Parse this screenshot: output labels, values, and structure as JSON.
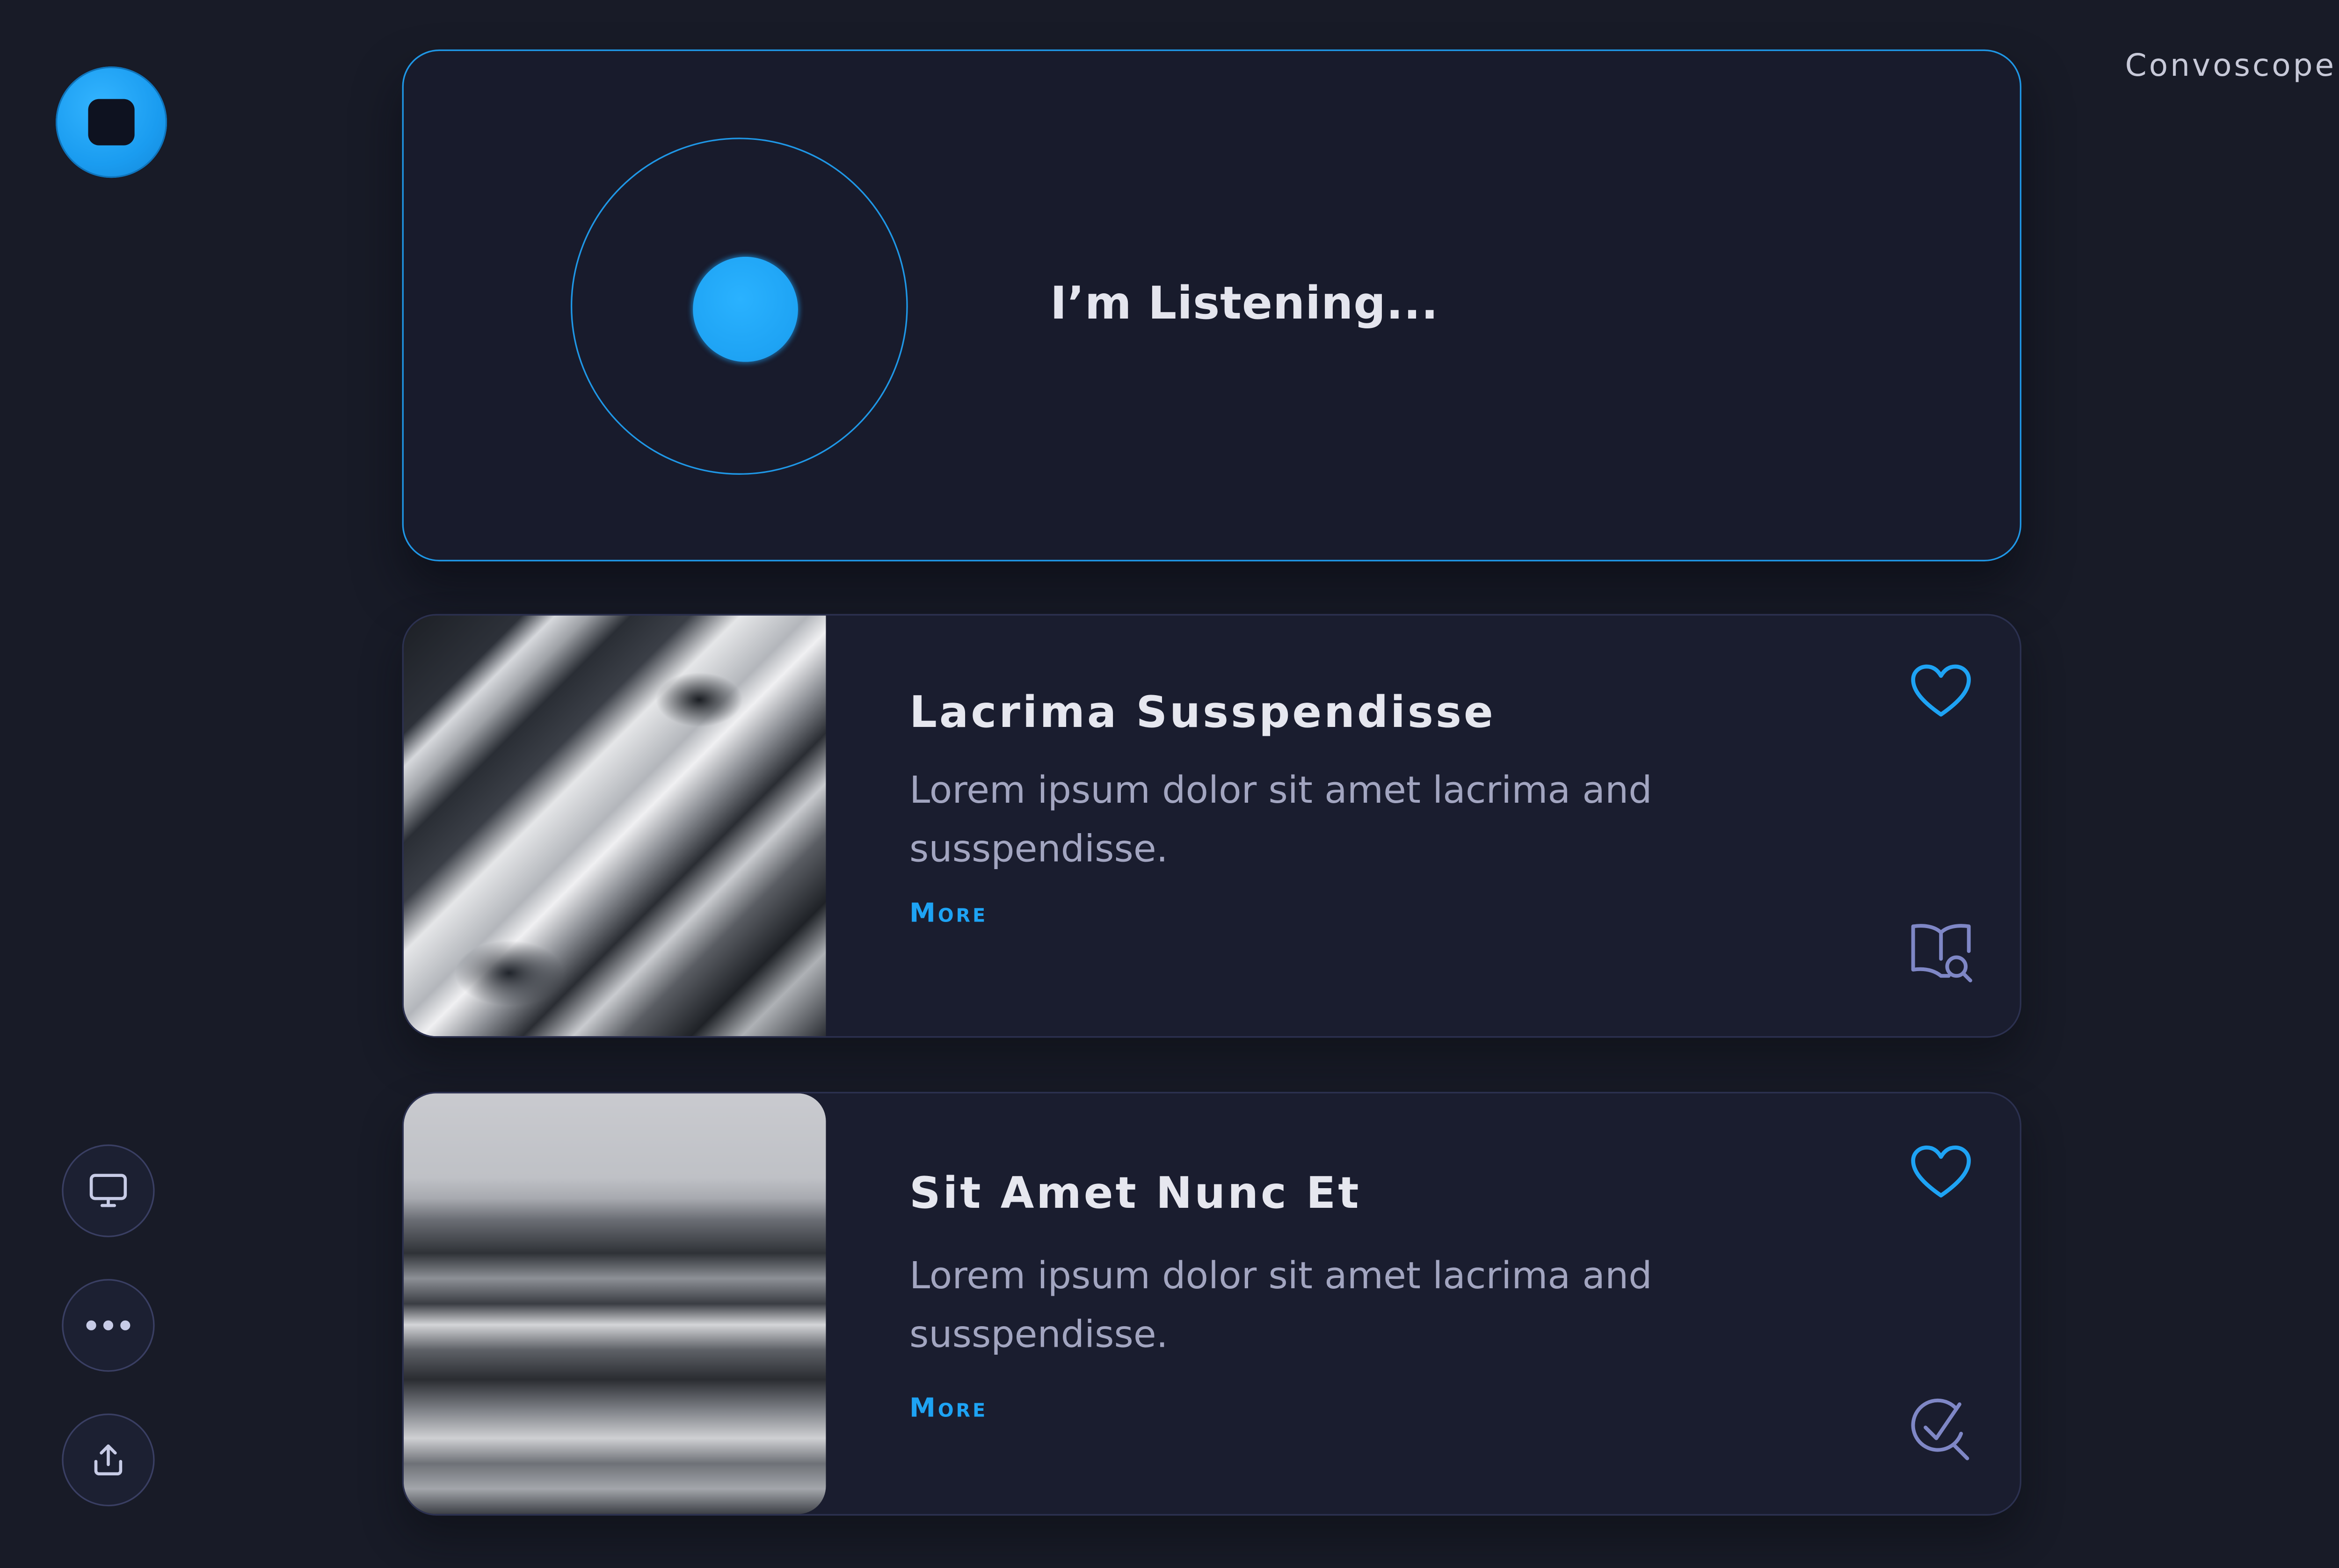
{
  "brand": {
    "name": "Convoscope"
  },
  "listening": {
    "status_text": "I’m Listening..."
  },
  "cards": [
    {
      "title": "Lacrima Susspendisse",
      "description": "Lorem ipsum dolor sit amet lacrima and susspendisse.",
      "more_label": "More",
      "image": "marble-photo",
      "action_icon": "book-search-icon"
    },
    {
      "title": "Sit Amet Nunc Et",
      "description": "Lorem ipsum dolor sit amet lacrima and susspendisse.",
      "more_label": "More",
      "image": "ocean-wave-photo",
      "action_icon": "check-search-icon"
    }
  ],
  "sidebar": {
    "icons": [
      "stop-icon",
      "monitor-icon",
      "more-icon",
      "share-icon"
    ]
  },
  "colors": {
    "background": "#181b27",
    "accent": "#1ea3f4",
    "card": "#1a1d2f",
    "card_border": "#2c3150",
    "text_primary": "#e6e7ef",
    "text_secondary": "#a2a5c0",
    "icon_muted": "#7f87c6"
  }
}
